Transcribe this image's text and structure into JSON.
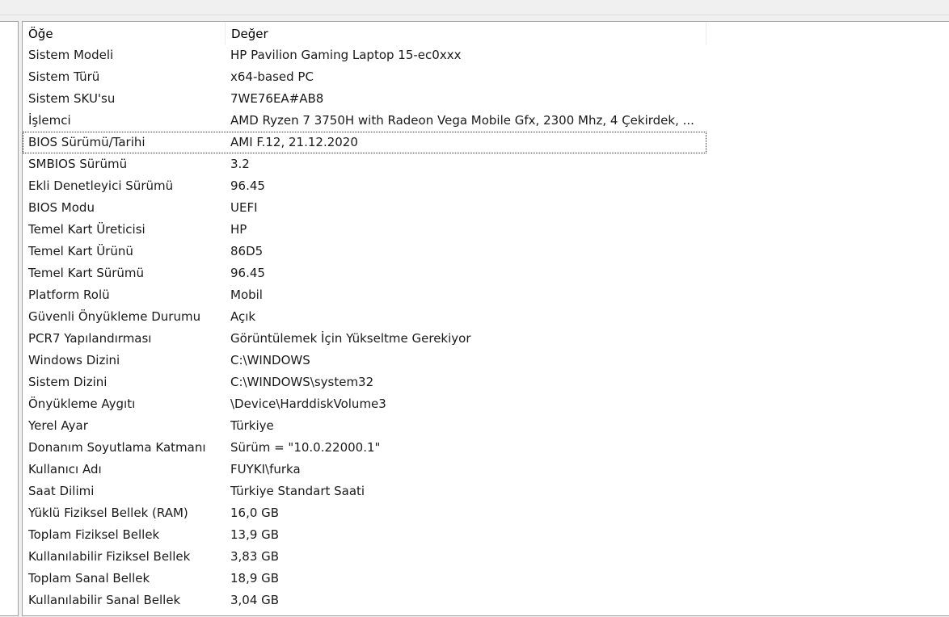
{
  "table": {
    "headers": {
      "item": "Öğe",
      "value": "Değer"
    },
    "rows": [
      {
        "item": "Sistem Modeli",
        "value": "HP Pavilion Gaming Laptop 15-ec0xxx"
      },
      {
        "item": "Sistem Türü",
        "value": "x64-based PC"
      },
      {
        "item": "Sistem SKU'su",
        "value": "7WE76EA#AB8"
      },
      {
        "item": "İşlemci",
        "value": "AMD Ryzen 7 3750H with Radeon Vega Mobile Gfx, 2300 Mhz, 4 Çekirdek, ..."
      },
      {
        "item": "BIOS Sürümü/Tarihi",
        "value": "AMI F.12, 21.12.2020"
      },
      {
        "item": "SMBIOS Sürümü",
        "value": "3.2"
      },
      {
        "item": "Ekli Denetleyici Sürümü",
        "value": "96.45"
      },
      {
        "item": "BIOS Modu",
        "value": "UEFI"
      },
      {
        "item": "Temel Kart Üreticisi",
        "value": "HP"
      },
      {
        "item": "Temel Kart Ürünü",
        "value": "86D5"
      },
      {
        "item": "Temel Kart Sürümü",
        "value": "96.45"
      },
      {
        "item": "Platform Rolü",
        "value": "Mobil"
      },
      {
        "item": "Güvenli Önyükleme Durumu",
        "value": "Açık"
      },
      {
        "item": "PCR7 Yapılandırması",
        "value": "Görüntülemek İçin Yükseltme Gerekiyor"
      },
      {
        "item": "Windows Dizini",
        "value": "C:\\WINDOWS"
      },
      {
        "item": "Sistem Dizini",
        "value": "C:\\WINDOWS\\system32"
      },
      {
        "item": "Önyükleme Aygıtı",
        "value": "\\Device\\HarddiskVolume3"
      },
      {
        "item": "Yerel Ayar",
        "value": "Türkiye"
      },
      {
        "item": "Donanım Soyutlama Katmanı",
        "value": "Sürüm = \"10.0.22000.1\""
      },
      {
        "item": "Kullanıcı Adı",
        "value": "FUYKI\\furka"
      },
      {
        "item": "Saat Dilimi",
        "value": "Türkiye Standart Saati"
      },
      {
        "item": "Yüklü Fiziksel Bellek (RAM)",
        "value": "16,0 GB"
      },
      {
        "item": "Toplam Fiziksel Bellek",
        "value": "13,9 GB"
      },
      {
        "item": "Kullanılabilir Fiziksel Bellek",
        "value": "3,83 GB"
      },
      {
        "item": "Toplam Sanal Bellek",
        "value": "18,9 GB"
      },
      {
        "item": "Kullanılabilir Sanal Bellek",
        "value": "3,04 GB"
      }
    ]
  }
}
